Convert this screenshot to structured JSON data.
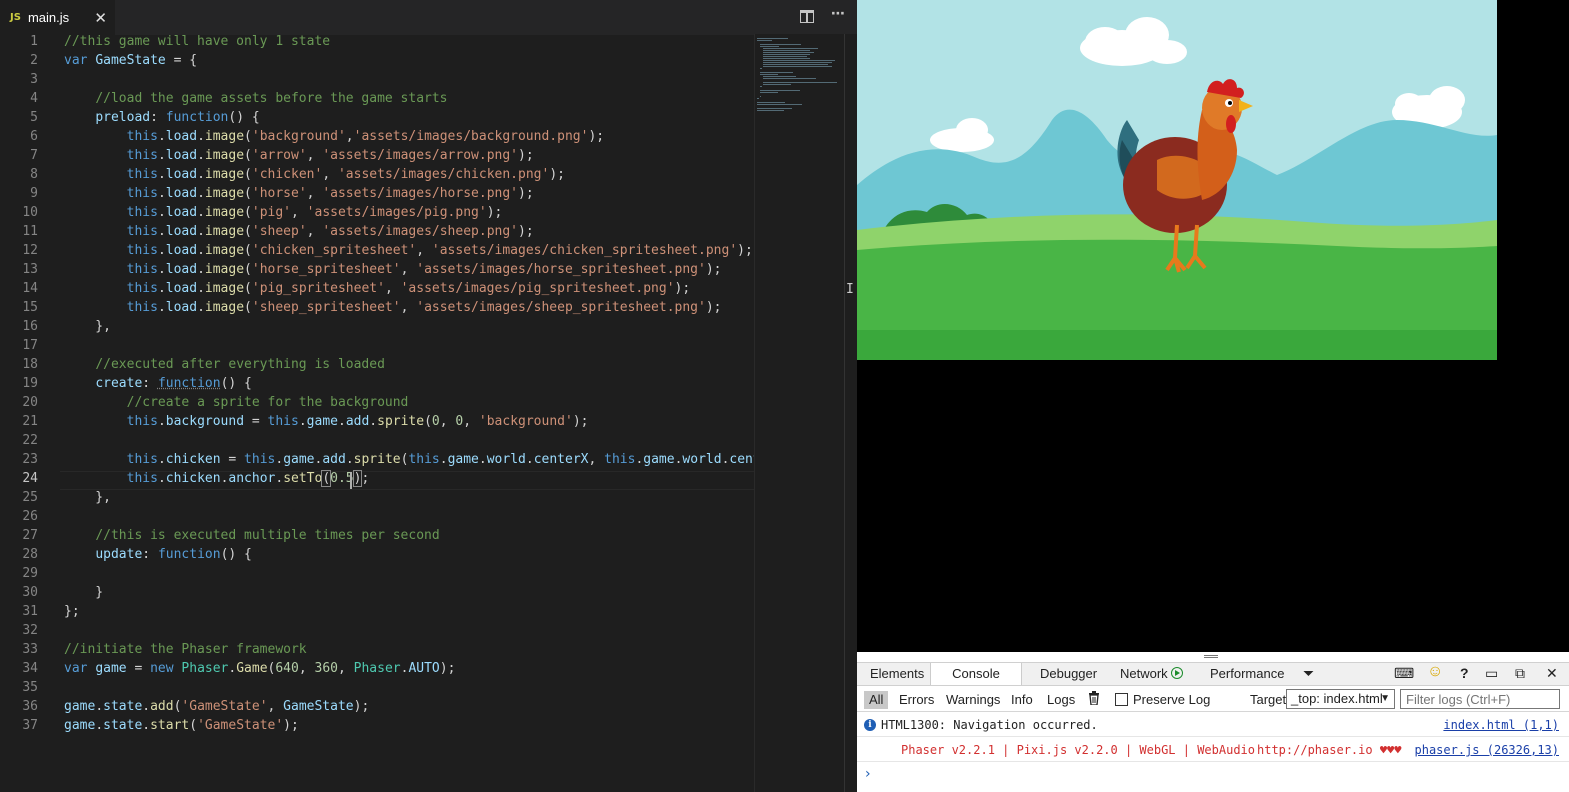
{
  "editor": {
    "tab": {
      "icon_text": "JS",
      "filename": "main.js",
      "close_glyph": "✕"
    },
    "actions": {
      "more_glyph": "⋯"
    },
    "lines": [
      {
        "n": "1",
        "html": "<span class='c'>//this game will have only 1 state</span>"
      },
      {
        "n": "2",
        "html": "<span class='k'>var</span> <span class='v'>GameState</span> = {"
      },
      {
        "n": "3",
        "html": ""
      },
      {
        "n": "4",
        "html": "    <span class='c'>//load the game assets before the game starts</span>"
      },
      {
        "n": "5",
        "html": "    <span class='v'>preload</span>: <span class='k'>function</span>() {"
      },
      {
        "n": "6",
        "html": "        <span class='k'>this</span>.<span class='v'>load</span>.<span class='f'>image</span>(<span class='s'>'background'</span>,<span class='s'>'assets/images/background.png'</span>);"
      },
      {
        "n": "7",
        "html": "        <span class='k'>this</span>.<span class='v'>load</span>.<span class='f'>image</span>(<span class='s'>'arrow'</span>, <span class='s'>'assets/images/arrow.png'</span>);"
      },
      {
        "n": "8",
        "html": "        <span class='k'>this</span>.<span class='v'>load</span>.<span class='f'>image</span>(<span class='s'>'chicken'</span>, <span class='s'>'assets/images/chicken.png'</span>);"
      },
      {
        "n": "9",
        "html": "        <span class='k'>this</span>.<span class='v'>load</span>.<span class='f'>image</span>(<span class='s'>'horse'</span>, <span class='s'>'assets/images/horse.png'</span>);"
      },
      {
        "n": "10",
        "html": "        <span class='k'>this</span>.<span class='v'>load</span>.<span class='f'>image</span>(<span class='s'>'pig'</span>, <span class='s'>'assets/images/pig.png'</span>);"
      },
      {
        "n": "11",
        "html": "        <span class='k'>this</span>.<span class='v'>load</span>.<span class='f'>image</span>(<span class='s'>'sheep'</span>, <span class='s'>'assets/images/sheep.png'</span>);"
      },
      {
        "n": "12",
        "html": "        <span class='k'>this</span>.<span class='v'>load</span>.<span class='f'>image</span>(<span class='s'>'chicken_spritesheet'</span>, <span class='s'>'assets/images/chicken_spritesheet.png'</span>);"
      },
      {
        "n": "13",
        "html": "        <span class='k'>this</span>.<span class='v'>load</span>.<span class='f'>image</span>(<span class='s'>'horse_spritesheet'</span>, <span class='s'>'assets/images/horse_spritesheet.png'</span>);"
      },
      {
        "n": "14",
        "html": "        <span class='k'>this</span>.<span class='v'>load</span>.<span class='f'>image</span>(<span class='s'>'pig_spritesheet'</span>, <span class='s'>'assets/images/pig_spritesheet.png'</span>);"
      },
      {
        "n": "15",
        "html": "        <span class='k'>this</span>.<span class='v'>load</span>.<span class='f'>image</span>(<span class='s'>'sheep_spritesheet'</span>, <span class='s'>'assets/images/sheep_spritesheet.png'</span>);"
      },
      {
        "n": "16",
        "html": "    },"
      },
      {
        "n": "17",
        "html": ""
      },
      {
        "n": "18",
        "html": "    <span class='c'>//executed after everything is loaded</span>"
      },
      {
        "n": "19",
        "html": "    <span class='v'>create</span>: <span class='k u'>function</span>() {"
      },
      {
        "n": "20",
        "html": "        <span class='c'>//create a sprite for the background</span>"
      },
      {
        "n": "21",
        "html": "        <span class='k'>this</span>.<span class='v'>background</span> = <span class='k'>this</span>.<span class='v'>game</span>.<span class='v'>add</span>.<span class='f'>sprite</span>(<span class='n'>0</span>, <span class='n'>0</span>, <span class='s'>'background'</span>);"
      },
      {
        "n": "22",
        "html": ""
      },
      {
        "n": "23",
        "html": "        <span class='k'>this</span>.<span class='v'>chicken</span> = <span class='k'>this</span>.<span class='v'>game</span>.<span class='v'>add</span>.<span class='f'>sprite</span>(<span class='k'>this</span>.<span class='v'>game</span>.<span class='v'>world</span>.<span class='v'>centerX</span>, <span class='k'>this</span>.<span class='v'>game</span>.<span class='v'>world</span>.<span class='v'>cente</span>"
      },
      {
        "n": "24",
        "html": "        <span class='k'>this</span>.<span class='v'>chicken</span>.<span class='v'>anchor</span>.<span class='f'>setTo</span><span class='b'>(</span><span class='n'>0.5</span><span class='b'>)</span>;"
      },
      {
        "n": "25",
        "html": "    },"
      },
      {
        "n": "26",
        "html": ""
      },
      {
        "n": "27",
        "html": "    <span class='c'>//this is executed multiple times per second</span>"
      },
      {
        "n": "28",
        "html": "    <span class='v'>update</span>: <span class='k'>function</span>() {"
      },
      {
        "n": "29",
        "html": ""
      },
      {
        "n": "30",
        "html": "    }"
      },
      {
        "n": "31",
        "html": "};"
      },
      {
        "n": "32",
        "html": ""
      },
      {
        "n": "33",
        "html": "<span class='c'>//initiate the Phaser framework</span>"
      },
      {
        "n": "34",
        "html": "<span class='k'>var</span> <span class='v'>game</span> = <span class='k'>new</span> <span class='t'>Phaser</span>.<span class='f'>Game</span>(<span class='n'>640</span>, <span class='n'>360</span>, <span class='t'>Phaser</span>.<span class='v'>AUTO</span>);"
      },
      {
        "n": "35",
        "html": ""
      },
      {
        "n": "36",
        "html": "<span class='v'>game</span>.<span class='v'>state</span>.<span class='f'>add</span>(<span class='s'>'GameState'</span>, <span class='v'>GameState</span>);"
      },
      {
        "n": "37",
        "html": "<span class='v'>game</span>.<span class='v'>state</span>.<span class='f'>start</span>(<span class='s'>'GameState'</span>);"
      }
    ],
    "active_line": "24"
  },
  "colors": {
    "comment": "#6a9955",
    "keyword": "#569cd6",
    "string": "#ce9178",
    "variable": "#9cdcfe",
    "function": "#dcdcaa",
    "number": "#b5cea8",
    "type": "#4ec9b0",
    "text": "#d4d4d4"
  },
  "devtools": {
    "tabs": [
      "Elements",
      "Console",
      "Debugger",
      "Network",
      "Performance"
    ],
    "selected_tab": "Console",
    "toolbar_glyphs": {
      "overflow": "⏷",
      "console": "⌨",
      "smile": "☺",
      "help": "?",
      "dock": "▭",
      "undock": "⧉",
      "close": "✕"
    },
    "filters": {
      "all": "All",
      "errors": "Errors",
      "warnings": "Warnings",
      "info": "Info",
      "logs": "Logs",
      "clear_icon": "trash-icon",
      "preserve_log": "Preserve Log",
      "target_label": "Target",
      "target_value": "_top: index.html",
      "filter_placeholder": "Filter logs (Ctrl+F)"
    },
    "messages": [
      {
        "text": "HTML1300: Navigation occurred.",
        "source": "index.html (1,1)"
      },
      {
        "text": "Phaser v2.2.1 | Pixi.js v2.2.0 | WebGL | WebAudio",
        "url": "http://phaser.io ♥♥♥",
        "source": "phaser.js (26326,13)"
      }
    ],
    "prompt_glyph": "›"
  }
}
